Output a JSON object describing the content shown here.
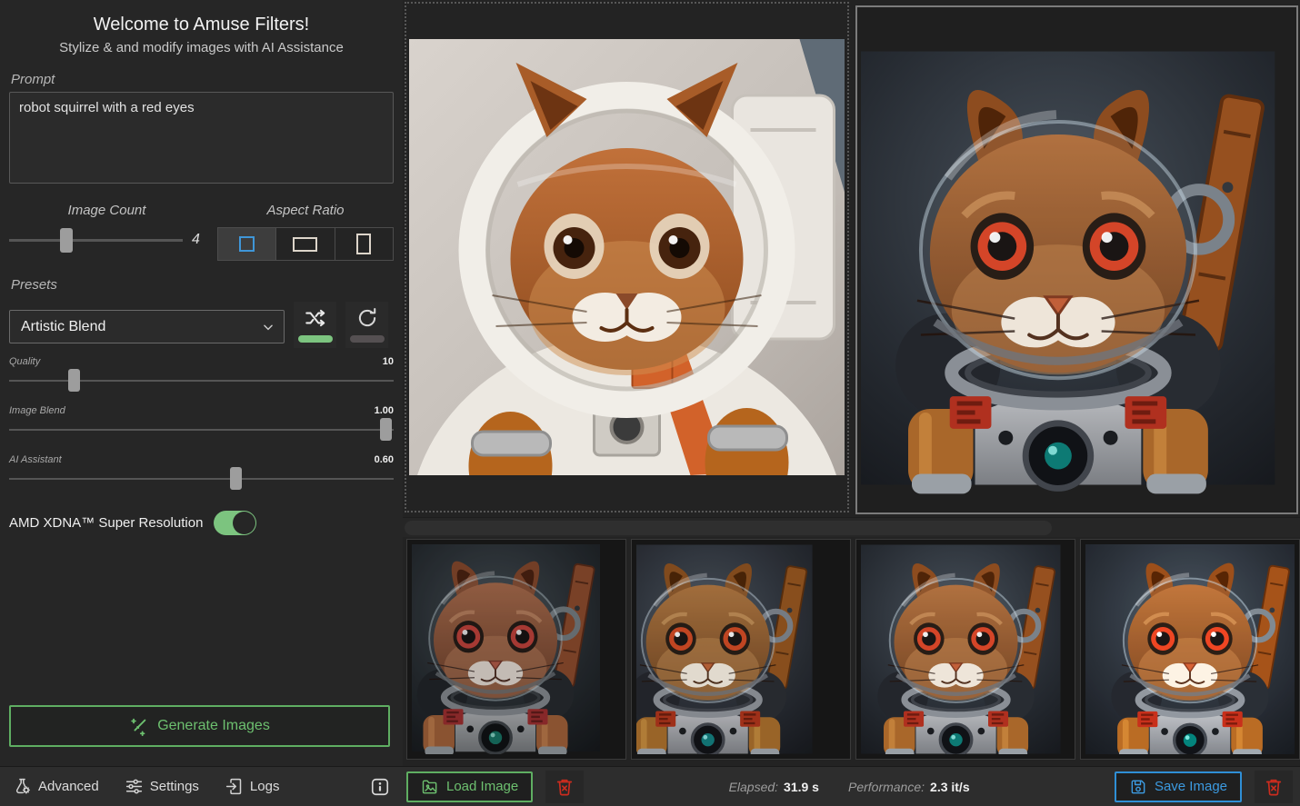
{
  "app": {
    "title": "Welcome to Amuse Filters!",
    "subtitle": "Stylize & and modify images with AI Assistance"
  },
  "colors": {
    "accent_green": "#6dc06f",
    "accent_blue": "#2f8fd6",
    "accent_red": "#cd2c1e"
  },
  "prompt": {
    "label": "Prompt",
    "value": "robot squirrel with a red eyes"
  },
  "image_count": {
    "label": "Image Count",
    "value": "4",
    "percent": 33
  },
  "aspect_ratio": {
    "label": "Aspect Ratio",
    "options": [
      {
        "name": "square",
        "selected": true
      },
      {
        "name": "landscape",
        "selected": false
      },
      {
        "name": "portrait",
        "selected": false
      }
    ]
  },
  "presets": {
    "label": "Presets",
    "selected": "Artistic Blend"
  },
  "preset_buttons": {
    "shuffle_enabled": true,
    "refresh_enabled": false
  },
  "sliders": [
    {
      "label": "Quality",
      "value": "10",
      "percent": 17
    },
    {
      "label": "Image Blend",
      "value": "1.00",
      "percent": 98
    },
    {
      "label": "AI Assistant",
      "value": "0.60",
      "percent": 59
    }
  ],
  "super_resolution": {
    "label": "AMD XDNA™ Super Resolution",
    "enabled": true
  },
  "generate": {
    "label": "Generate Images"
  },
  "gallery": {
    "input_alt": "Photo-style squirrel in white astronaut suit with helmet (loaded input image)",
    "output_alt": "Generated robot squirrel with red eyes in dark sci-fi suit with glass visor",
    "thumbnails": [
      {
        "alt": "Variant 1: robot squirrel, dark navy suit, cyan shoulder patch"
      },
      {
        "alt": "Variant 2: robot squirrel, charcoal suit, red lights"
      },
      {
        "alt": "Variant 3: robot squirrel, silver suit, glass dome (shown in preview)"
      },
      {
        "alt": "Variant 4: robot squirrel, silver suit, orange sash"
      }
    ]
  },
  "statusbar": {
    "advanced": "Advanced",
    "settings": "Settings",
    "logs": "Logs",
    "load_image": "Load Image",
    "elapsed_label": "Elapsed:",
    "elapsed_value": "31.9 s",
    "performance_label": "Performance:",
    "performance_value": "2.3 it/s",
    "save_image": "Save Image"
  }
}
